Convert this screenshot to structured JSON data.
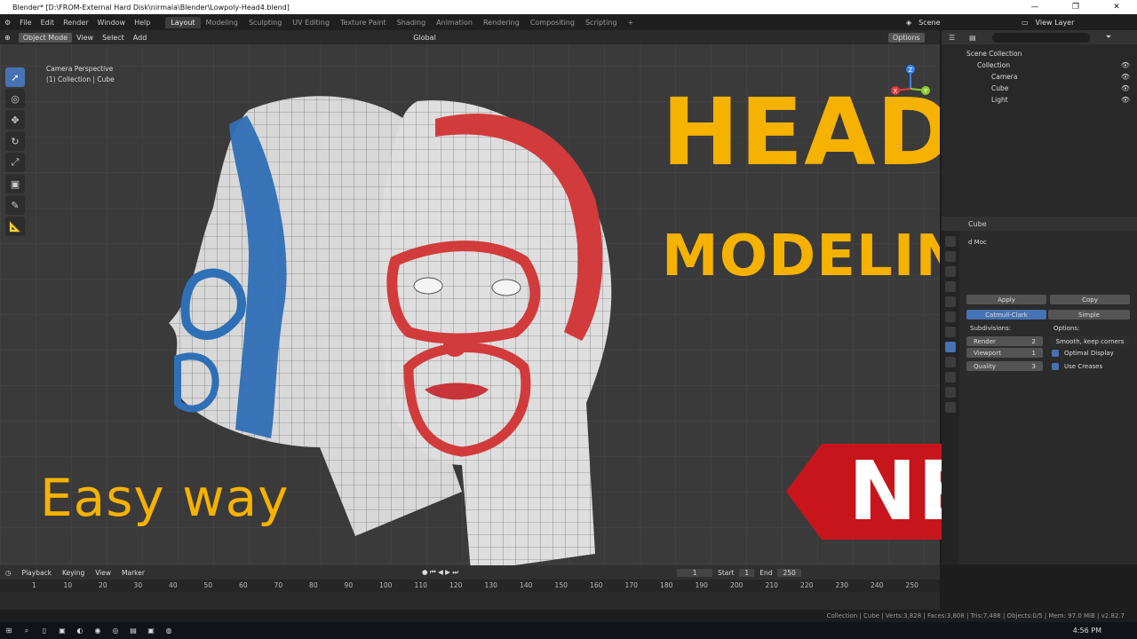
{
  "window": {
    "title": "Blender* [D:\\FROM-External Hard Disk\\nirmala\\Blender\\Lowpoly-Head4.blend]",
    "minimize": "—",
    "maximize": "❐",
    "close": "✕"
  },
  "menu": {
    "items": [
      "File",
      "Edit",
      "Render",
      "Window",
      "Help"
    ]
  },
  "workspaces": [
    "Layout",
    "Modeling",
    "Sculpting",
    "UV Editing",
    "Texture Paint",
    "Shading",
    "Animation",
    "Rendering",
    "Compositing",
    "Scripting"
  ],
  "active_workspace": "Layout",
  "scene": {
    "label": "Scene",
    "view_layer": "View Layer"
  },
  "viewport": {
    "mode": "Object Mode",
    "menus": [
      "View",
      "Select",
      "Add"
    ],
    "transform": "Global",
    "options": "Options",
    "overlay_line1": "Camera Perspective",
    "overlay_line2": "(1) Collection | Cube",
    "axes": {
      "z": "Z",
      "x": "X",
      "y": "Y"
    }
  },
  "thumbnail": {
    "head": "HEAD",
    "modeling": "MODELING",
    "easy": "Easy way",
    "new": "NEW",
    "accent": "#f6b200",
    "banner": "#c8151b"
  },
  "outliner": {
    "root": "Scene Collection",
    "collection": "Collection",
    "items": [
      "Camera",
      "Cube",
      "Light"
    ]
  },
  "properties": {
    "object": "Cube",
    "modifier_short": "d Moc",
    "apply": "Apply",
    "copy": "Copy",
    "catmull": "Catmull-Clark",
    "simple": "Simple",
    "subdivisions": "Subdivisions:",
    "options": "Options:",
    "render_label": "Render",
    "render_val": "2",
    "viewport_label": "Viewport",
    "viewport_val": "1",
    "quality_label": "Quality",
    "quality_val": "3",
    "smooth": "Smooth, keep corners",
    "optimal": "Optimal Display",
    "creases": "Use Creases"
  },
  "timeline": {
    "menus": [
      "Playback",
      "Keying",
      "View",
      "Marker"
    ],
    "current": "1",
    "start_label": "Start",
    "start": "1",
    "end_label": "End",
    "end": "250",
    "ticks": [
      "1",
      "10",
      "20",
      "30",
      "40",
      "50",
      "60",
      "70",
      "80",
      "90",
      "100",
      "110",
      "120",
      "130",
      "140",
      "150",
      "160",
      "170",
      "180",
      "190",
      "200",
      "210",
      "220",
      "230",
      "240",
      "250"
    ]
  },
  "status": "Collection | Cube | Verts:3,828 | Faces:3,808 | Tris:7,488 | Objects:0/5 | Mem: 97.0 MiB | v2.82.7",
  "taskbar": {
    "time": "4:56 PM"
  }
}
